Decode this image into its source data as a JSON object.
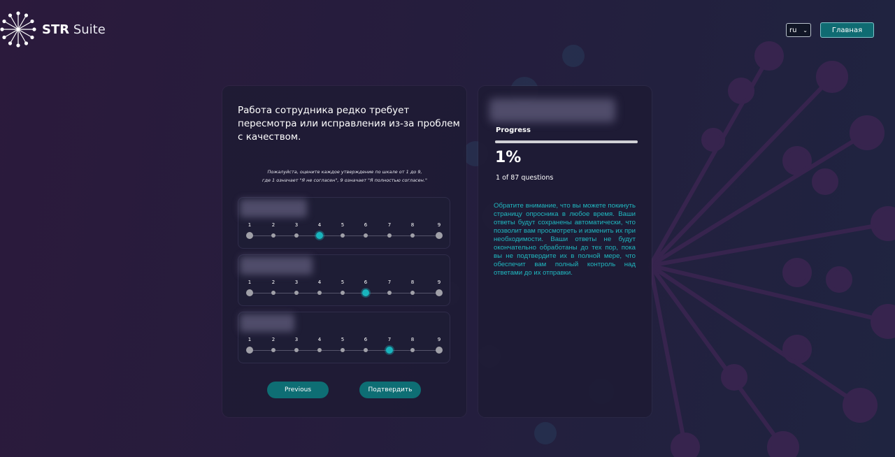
{
  "header": {
    "brand_bold": "STR",
    "brand_light": "Suite",
    "language": "ru",
    "home_label": "Главная"
  },
  "survey": {
    "question": "Работа сотрудника редко требует пересмотра или исправления из-за проблем с качеством.",
    "instruction_line1": "Пожалуйста, оцените каждое утверждение по шкале от 1 до 9,",
    "instruction_line2": "где 1 означает \"Я не согласен\", 9 означает \"Я полностью согласен.\"",
    "scale_labels": [
      "1",
      "2",
      "3",
      "4",
      "5",
      "6",
      "7",
      "8",
      "9"
    ],
    "items": [
      {
        "selected": 4
      },
      {
        "selected": 6
      },
      {
        "selected": 7
      }
    ],
    "previous_label": "Previous",
    "submit_label": "Подтвердить"
  },
  "progress": {
    "label": "Progress",
    "percent_text": "1%",
    "percent_value": 1,
    "count_text": "1 of 87 questions"
  },
  "notice": "Обратите внимание, что вы можете покинуть страницу опросника в любое время. Ваши ответы будут сохранены автоматически, что позволит вам просмотреть и изменить их при необходимости. Ваши ответы не будут окончательно обработаны до тех пор, пока вы не подтвердите их в полной мере, что обеспечит вам полный контроль над ответами до их отправки.",
  "colors": {
    "accent": "#19b4bd",
    "button": "#0e6e74",
    "card": "#1e1b34"
  },
  "icons": {
    "logo": "starburst-logo-icon",
    "select": "chevron-down-icon"
  }
}
